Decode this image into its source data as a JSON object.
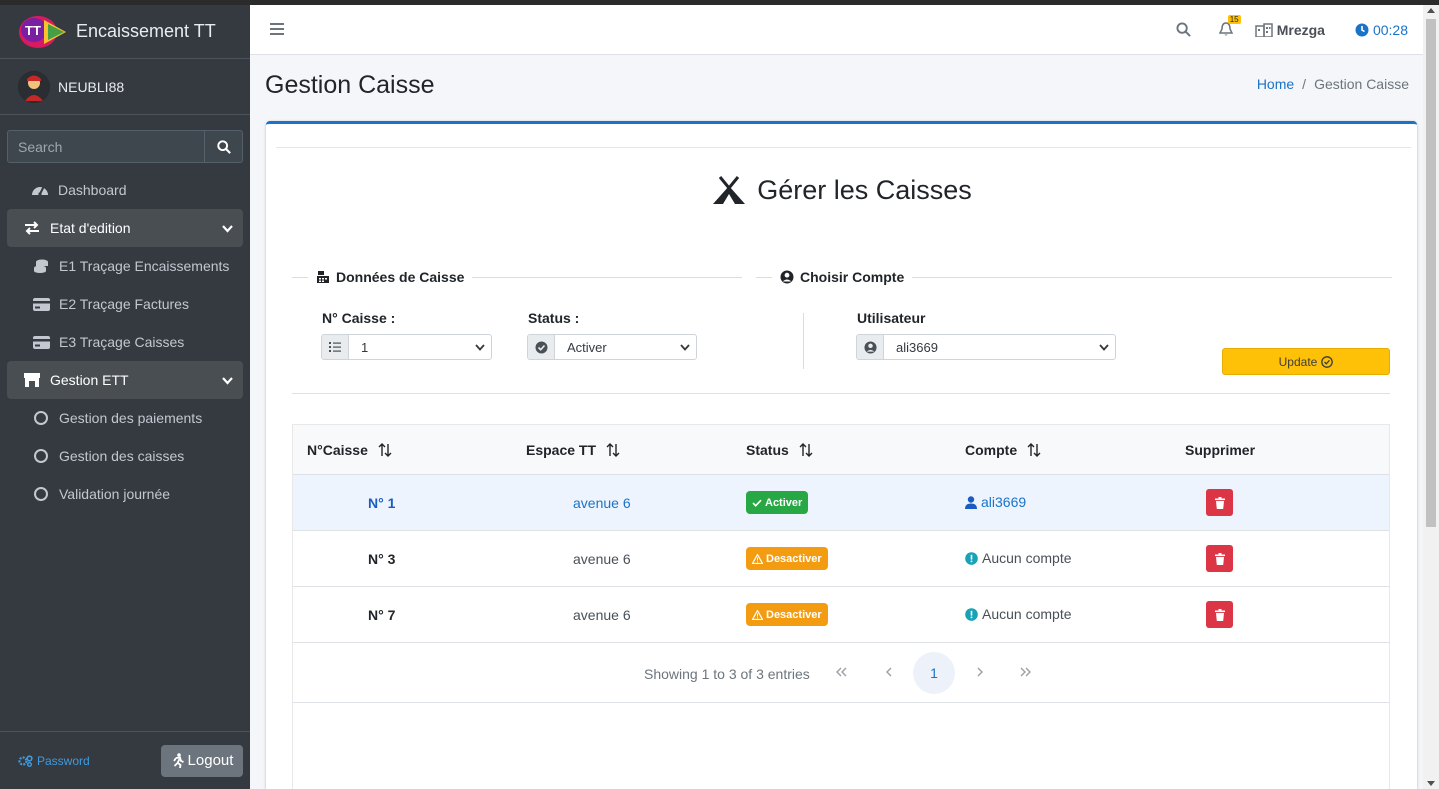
{
  "app": {
    "brand_name": "Encaissement TT",
    "logo_text": "TT",
    "user_name": "NEUBLI88"
  },
  "sidebar": {
    "search_placeholder": "Search",
    "items": [
      {
        "label": "Dashboard"
      },
      {
        "label": "Etat d'edition"
      },
      {
        "label": "E1 Traçage Encaissements"
      },
      {
        "label": "E2 Traçage Factures"
      },
      {
        "label": "E3 Traçage Caisses"
      },
      {
        "label": "Gestion ETT"
      },
      {
        "label": "Gestion des paiements"
      },
      {
        "label": "Gestion des caisses"
      },
      {
        "label": "Validation journée"
      }
    ],
    "password_label": "Password",
    "logout_label": "Logout"
  },
  "navbar": {
    "notif_count": "15",
    "org_name": "Mrezga",
    "clock": "00:28"
  },
  "page": {
    "title": "Gestion Caisse",
    "breadcrumb_home": "Home",
    "breadcrumb_sep": "/",
    "breadcrumb_current": "Gestion Caisse"
  },
  "card": {
    "title": "Gérer les Caisses",
    "legend_caisse": "Données de Caisse",
    "legend_compte": "Choisir Compte",
    "label_num_caisse": "N° Caisse :",
    "label_status": "Status :",
    "label_utilisateur": "Utilisateur",
    "num_caisse_value": "1",
    "status_value": "Activer",
    "utilisateur_value": "ali3669",
    "update_label": "Update"
  },
  "table": {
    "headers": [
      "N°Caisse",
      "Espace TT",
      "Status",
      "Compte",
      "Supprimer"
    ],
    "rows": [
      {
        "num": "N° 1",
        "espace": "avenue 6",
        "status": "Activer",
        "compte": "ali3669"
      },
      {
        "num": "N° 3",
        "espace": "avenue 6",
        "status": "Desactiver",
        "compte": "Aucun compte"
      },
      {
        "num": "N° 7",
        "espace": "avenue 6",
        "status": "Desactiver",
        "compte": "Aucun compte"
      }
    ],
    "info": "Showing 1 to 3 of 3 entries",
    "current_page": "1"
  },
  "colors": {
    "sidebar_bg": "#343a40",
    "primary": "#1a73c8",
    "success": "#28a745",
    "warning": "#f39c12",
    "danger": "#dc3545",
    "update_btn": "#ffc107"
  }
}
